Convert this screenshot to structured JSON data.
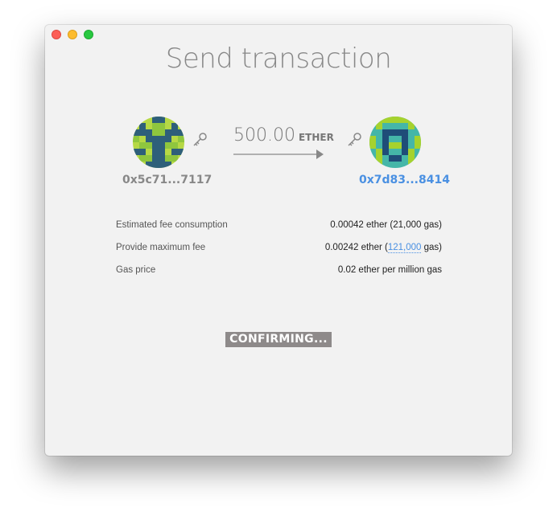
{
  "window": {
    "title": "Send transaction"
  },
  "from": {
    "address": "0x5c71...7117",
    "identicon_colors": [
      "#b6d845",
      "#2e5f7a",
      "#8fc63e"
    ]
  },
  "to": {
    "address": "0x7d83...8414",
    "identicon_colors": [
      "#45b6a8",
      "#1f4d78",
      "#a6d22e"
    ]
  },
  "amount": {
    "value": "500.00",
    "unit": "ETHER"
  },
  "fees": {
    "estimated": {
      "label": "Estimated fee consumption",
      "value": "0.00042 ether (21,000 gas)"
    },
    "maximum": {
      "label": "Provide maximum fee",
      "value_prefix": "0.00242 ether (",
      "gas_link": "121,000",
      "value_suffix": " gas)"
    },
    "gas_price": {
      "label": "Gas price",
      "value": "0.02 ether per million gas"
    }
  },
  "status": {
    "label": "CONFIRMING..."
  },
  "colors": {
    "link": "#4a90e2",
    "status_bg": "#8e8a8a"
  }
}
